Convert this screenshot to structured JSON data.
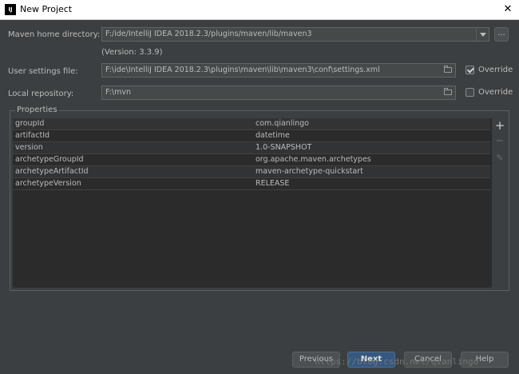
{
  "window": {
    "title": "New Project",
    "app_icon": "IJ"
  },
  "maven_home": {
    "label": "Maven home directory:",
    "value": "F:/ide/IntelliJ IDEA 2018.2.3/plugins/maven/lib/maven3",
    "version": "(Version: 3.3.9)",
    "browse_label": "..."
  },
  "user_settings": {
    "label": "User settings file:",
    "value": "F:\\ide\\IntelliJ IDEA 2018.2.3\\plugins\\maven\\lib\\maven3\\conf\\settings.xml",
    "override_label": "Override",
    "override_checked": true
  },
  "local_repo": {
    "label": "Local repository:",
    "value": "F:\\mvn",
    "override_label": "Override",
    "override_checked": false
  },
  "properties": {
    "legend": "Properties",
    "rows": [
      {
        "key": "groupId",
        "value": "com.qianlingo"
      },
      {
        "key": "artifactId",
        "value": "datetime"
      },
      {
        "key": "version",
        "value": "1.0-SNAPSHOT"
      },
      {
        "key": "archetypeGroupId",
        "value": "org.apache.maven.archetypes"
      },
      {
        "key": "archetypeArtifactId",
        "value": "maven-archetype-quickstart"
      },
      {
        "key": "archetypeVersion",
        "value": "RELEASE"
      }
    ],
    "add_icon": "+",
    "remove_icon": "−",
    "edit_icon": "✎"
  },
  "buttons": {
    "previous": "Previous",
    "next": "Next",
    "cancel": "Cancel",
    "help": "Help"
  },
  "watermark": "https://blog.csdn.net/qianlingo",
  "close_icon": "✕"
}
